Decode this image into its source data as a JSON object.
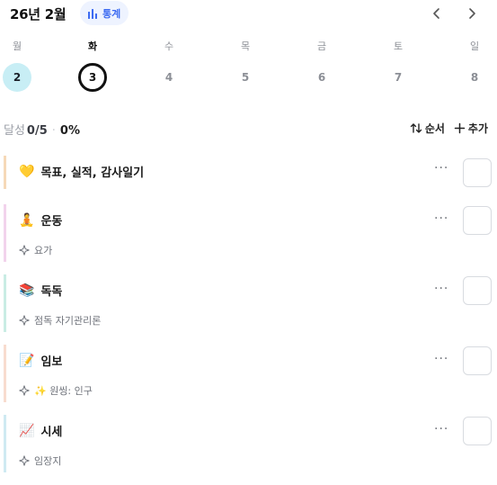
{
  "header": {
    "month_title": "26년 2월",
    "stats_label": "통계",
    "accent": "#3d6bf2"
  },
  "week": {
    "weekdays": [
      "월",
      "화",
      "수",
      "목",
      "금",
      "토",
      "일"
    ],
    "days": [
      "2",
      "3",
      "4",
      "5",
      "6",
      "7",
      "8"
    ],
    "today_index": 0,
    "selected_index": 1
  },
  "progress": {
    "label": "달성",
    "count": "0/5",
    "separator": "·",
    "percent": "0%"
  },
  "tools": {
    "sort_label": "순서",
    "add_label": "추가"
  },
  "goals": [
    {
      "emoji": "💛",
      "title": "목표, 실적, 감사일기",
      "subtitle": "",
      "color": "#f6d9b8",
      "more": "···"
    },
    {
      "emoji": "🧘",
      "title": "운동",
      "subtitle": "요가",
      "color": "#f2d3ec",
      "more": "···"
    },
    {
      "emoji": "📚",
      "title": "독독",
      "subtitle": "점독 자기관리론",
      "color": "#c9ece4",
      "more": "···"
    },
    {
      "emoji": "📝",
      "title": "임보",
      "subtitle": "✨ 원씽: 인구",
      "color": "#f8dccf",
      "more": "···"
    },
    {
      "emoji": "📈",
      "title": "시세",
      "subtitle": "임장지",
      "color": "#cfeaf2",
      "more": "···"
    }
  ],
  "icons": {
    "stats": "bar-chart-icon",
    "prev": "chevron-left-icon",
    "next": "chevron-right-icon",
    "sort": "sort-arrows-icon",
    "add": "plus-icon",
    "subtask": "sparkle-outline-icon"
  }
}
